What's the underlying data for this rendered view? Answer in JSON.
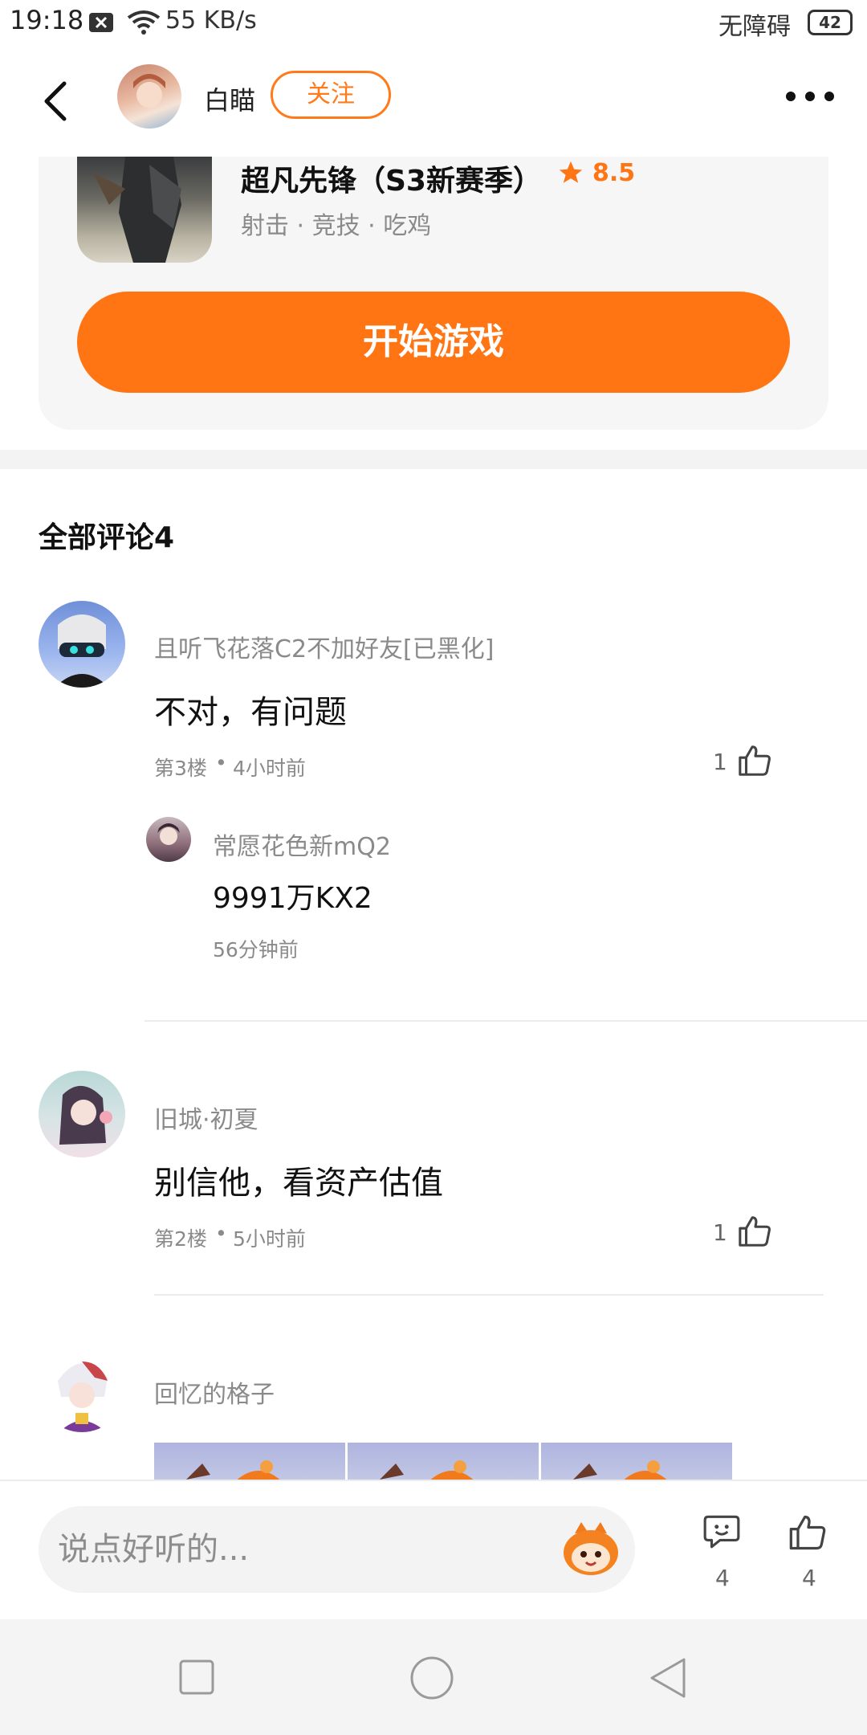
{
  "status_bar": {
    "time": "19:18",
    "network_speed": "55 KB/s",
    "accessibility": "无障碍",
    "battery": "42"
  },
  "header": {
    "username": "白瞄",
    "follow_label": "关注"
  },
  "game": {
    "title": "超凡先锋（S3新赛季）",
    "rating": "8.5",
    "tags": "射击 · 竞技 · 吃鸡",
    "start_label": "开始游戏"
  },
  "comments_title": "全部评论4",
  "comments": [
    {
      "user": "且听飞花落C2不加好友[已黑化]",
      "text": "不对，有问题",
      "floor": "第3楼",
      "time": "4小时前",
      "likes": "1",
      "reply": {
        "user": "常愿花色新mQ2",
        "text": "9991万KX2",
        "time": "56分钟前"
      }
    },
    {
      "user": "旧城·初夏",
      "text": "别信他，看资产估值",
      "floor": "第2楼",
      "time": "5小时前",
      "likes": "1"
    },
    {
      "user": "回忆的格子"
    }
  ],
  "bottom": {
    "input_placeholder": "说点好听的...",
    "comment_count": "4",
    "like_count": "4"
  },
  "colors": {
    "accent": "#ff7514"
  }
}
